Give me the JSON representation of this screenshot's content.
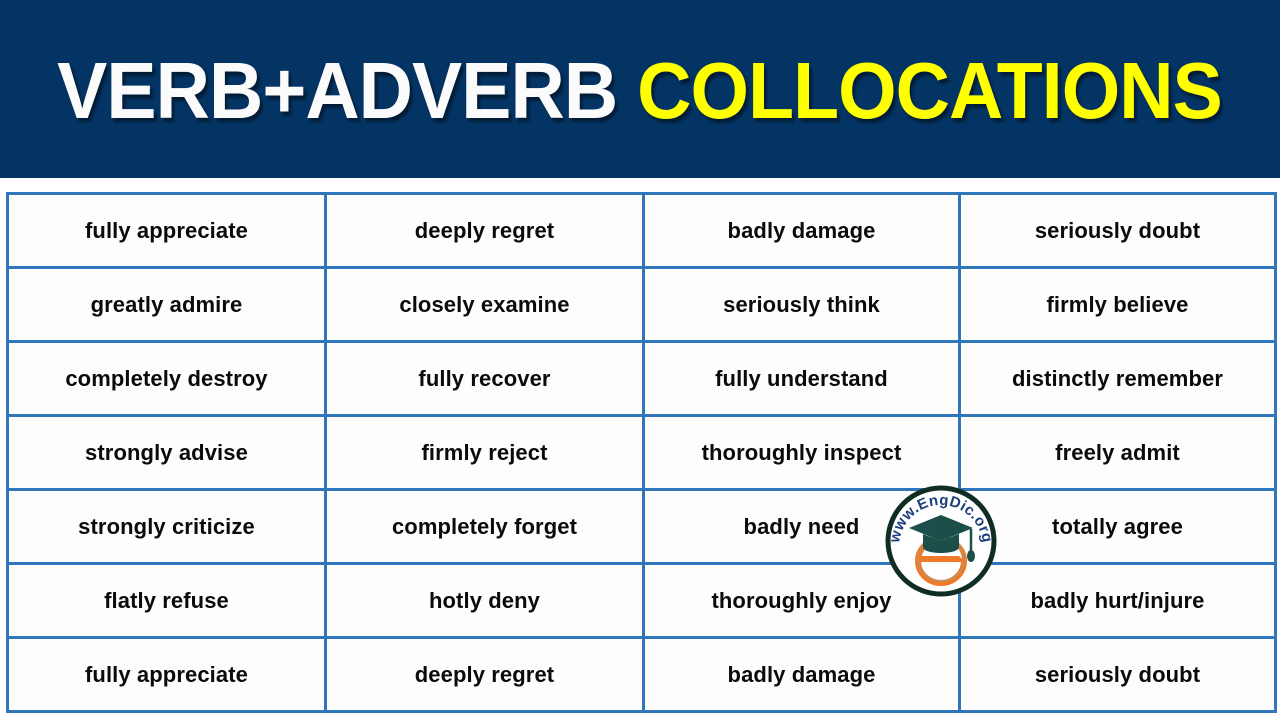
{
  "header": {
    "title_main": "VERB+ADVERB",
    "title_accent": "COLLOCATIONS",
    "background_color": "#043464",
    "main_color": "#fbfbfb",
    "accent_color": "#ffff00"
  },
  "table": {
    "border_color": "#2f76bd",
    "cell_background": "#fdfdfb",
    "text_color": "#0b0b0b",
    "columns": 4,
    "rows": 7,
    "cells": [
      [
        "fully appreciate",
        "deeply regret",
        "badly damage",
        "seriously doubt"
      ],
      [
        "greatly admire",
        "closely examine",
        "seriously think",
        "firmly believe"
      ],
      [
        "completely destroy",
        "fully recover",
        "fully understand",
        "distinctly remember"
      ],
      [
        "strongly advise",
        "firmly reject",
        "thoroughly inspect",
        "freely admit"
      ],
      [
        "strongly criticize",
        "completely forget",
        "badly need",
        "totally agree"
      ],
      [
        "flatly refuse",
        "hotly deny",
        "thoroughly enjoy",
        "badly hurt/injure"
      ],
      [
        "fully appreciate",
        "deeply regret",
        "badly damage",
        "seriously doubt"
      ]
    ]
  },
  "watermark": {
    "text": "www.EngDic.org",
    "letter": "e",
    "ring_color": "#0f2d24",
    "text_color": "#1d3f7a",
    "cap_color": "#1d4f4a",
    "letter_color": "#ef7a28"
  }
}
